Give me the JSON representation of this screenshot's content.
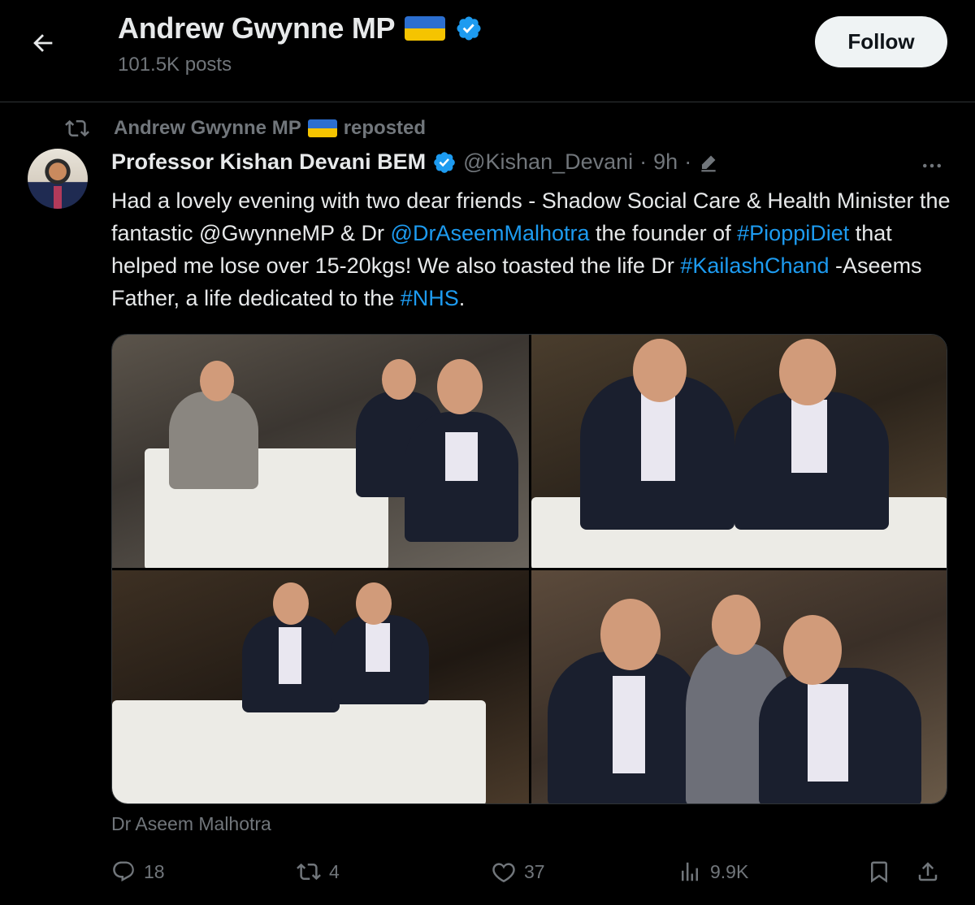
{
  "header": {
    "title": "Andrew Gwynne MP",
    "posts_count": "101.5K posts",
    "follow_label": "Follow"
  },
  "repost": {
    "name": "Andrew Gwynne MP",
    "label": "reposted"
  },
  "tweet": {
    "author_name": "Professor Kishan Devani BEM",
    "handle": "@Kishan_Devani",
    "dot": "·",
    "time": "9h",
    "dot2": "·",
    "text_parts": [
      "Had a lovely evening with two dear friends - Shadow Social Care & Health Minister the fantastic @GwynneMP & Dr ",
      "@DrAseemMalhotra",
      " the founder of ",
      "#PioppiDiet",
      " that helped me lose over 15-20kgs! We also toasted the life Dr ",
      "#KailashChand",
      " -Aseems Father, a life dedicated to the ",
      "#NHS",
      "."
    ],
    "attribution": "Dr Aseem Malhotra"
  },
  "actions": {
    "replies": "18",
    "reposts": "4",
    "likes": "37",
    "views": "9.9K"
  },
  "icons": {
    "back": "arrow-left-icon",
    "verified": "verified-badge-icon",
    "repost": "repost-icon",
    "edit": "edit-pencil-icon",
    "more": "more-dots-icon",
    "reply": "reply-bubble-icon",
    "like": "heart-icon",
    "views": "views-bars-icon",
    "bookmark": "bookmark-icon",
    "share": "share-icon"
  },
  "colors": {
    "background": "#000000",
    "text": "#e7e9ea",
    "muted": "#71767b",
    "link": "#1d9bf0",
    "verified": "#1d9bf0",
    "follow_bg": "#eff3f4",
    "flag_blue": "#2c6fd0",
    "flag_yellow": "#f5c400"
  }
}
